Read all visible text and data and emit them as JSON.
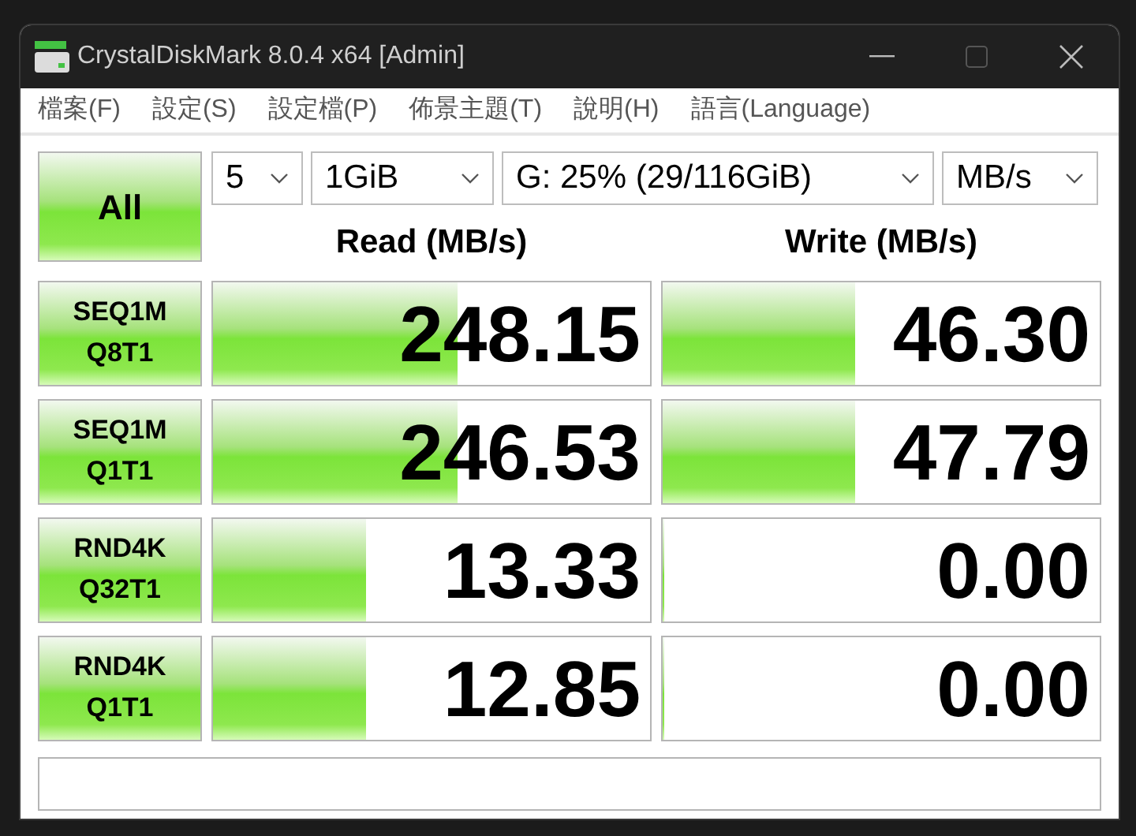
{
  "window": {
    "title": "CrystalDiskMark 8.0.4 x64 [Admin]"
  },
  "menu": [
    "檔案(F)",
    "設定(S)",
    "設定檔(P)",
    "佈景主題(T)",
    "說明(H)",
    "語言(Language)"
  ],
  "all_button": "All",
  "selectors": {
    "count": "5",
    "size": "1GiB",
    "drive": "G: 25% (29/116GiB)",
    "unit": "MB/s"
  },
  "headers": {
    "read": "Read (MB/s)",
    "write": "Write (MB/s)"
  },
  "tests": [
    {
      "line1": "SEQ1M",
      "line2": "Q8T1",
      "read": {
        "value": "248.15",
        "level": 0.56
      },
      "write": {
        "value": "46.30",
        "level": 0.44
      }
    },
    {
      "line1": "SEQ1M",
      "line2": "Q1T1",
      "read": {
        "value": "246.53",
        "level": 0.56
      },
      "write": {
        "value": "47.79",
        "level": 0.44
      }
    },
    {
      "line1": "RND4K",
      "line2": "Q32T1",
      "read": {
        "value": "13.33",
        "level": 0.35
      },
      "write": {
        "value": "0.00",
        "level": 0
      }
    },
    {
      "line1": "RND4K",
      "line2": "Q1T1",
      "read": {
        "value": "12.85",
        "level": 0.35
      },
      "write": {
        "value": "0.00",
        "level": 0
      }
    }
  ]
}
